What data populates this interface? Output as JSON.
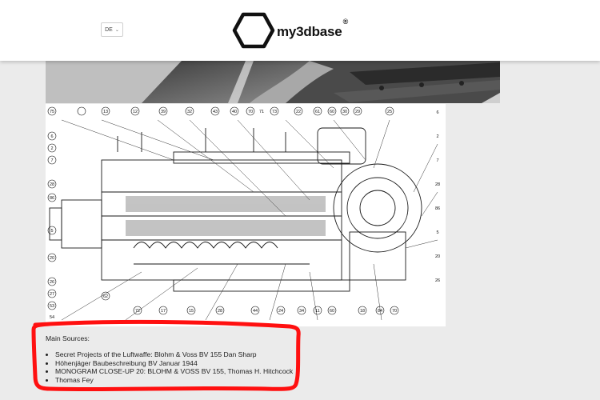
{
  "header": {
    "language": "DE",
    "logo_text": "my3dbase",
    "logo_reg": "®"
  },
  "content": {
    "sources_title": "Main Sources:",
    "sources": [
      "Secret Projects of the Luftwaffe: Blohm & Voss BV 155 Dan Sharp",
      "Höhenjäger Baubeschreibung BV Januar 1944",
      "MONOGRAM CLOSE-UP 20: BLOHM & VOSS BV 155, Thomas H. Hitchcock",
      "Thomas Fey"
    ]
  },
  "drawing": {
    "left_numbers": [
      "75",
      "6",
      "2",
      "7",
      "28",
      "86",
      "5",
      "20",
      "26",
      "27",
      "53",
      "54"
    ],
    "top_numbers": [
      "13",
      "12",
      "39",
      "32",
      "43",
      "40",
      "70",
      "71",
      "73",
      "22",
      "61",
      "60",
      "30",
      "29",
      "25"
    ],
    "bottom_numbers": [
      "62",
      "72",
      "17",
      "15",
      "28",
      "44",
      "24",
      "34",
      "11",
      "60",
      "18",
      "84",
      "70"
    ],
    "right_numbers": [
      "6",
      "2",
      "7",
      "28",
      "86",
      "5",
      "20",
      "26"
    ]
  },
  "colors": {
    "header_bg": "#ffffff",
    "page_bg": "#ebebeb",
    "annotation": "#ff1010"
  }
}
